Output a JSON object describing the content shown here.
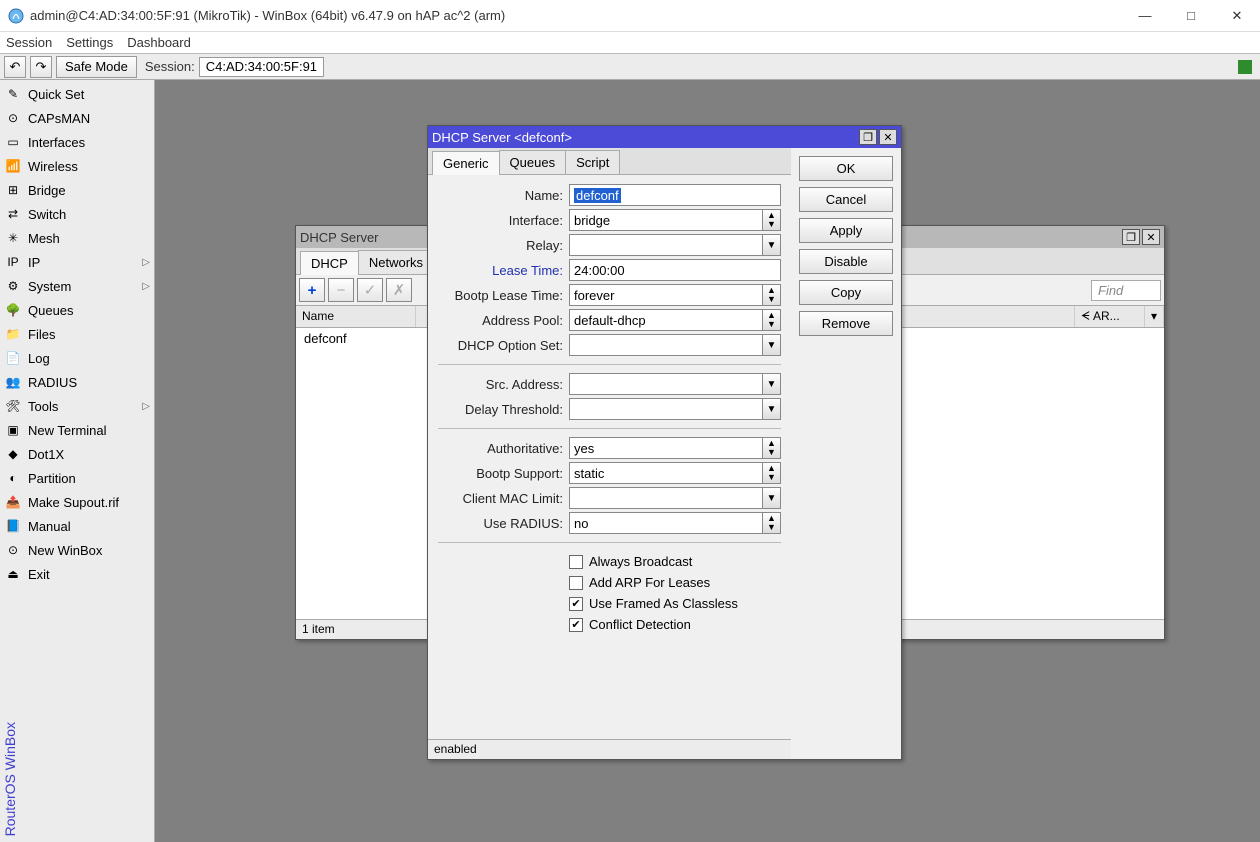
{
  "titlebar": "admin@C4:AD:34:00:5F:91 (MikroTik) - WinBox (64bit) v6.47.9 on hAP ac^2 (arm)",
  "menu": {
    "session": "Session",
    "settings": "Settings",
    "dashboard": "Dashboard"
  },
  "toolbar": {
    "safemode": "Safe Mode",
    "sessionlabel": "Session:",
    "sessionvalue": "C4:AD:34:00:5F:91"
  },
  "sidebar": [
    {
      "label": "Quick Set",
      "icon": "✎",
      "arrow": false
    },
    {
      "label": "CAPsMAN",
      "icon": "⊙",
      "arrow": false
    },
    {
      "label": "Interfaces",
      "icon": "▭",
      "arrow": false
    },
    {
      "label": "Wireless",
      "icon": "📶",
      "arrow": false
    },
    {
      "label": "Bridge",
      "icon": "⊞",
      "arrow": false
    },
    {
      "label": "Switch",
      "icon": "⇄",
      "arrow": false
    },
    {
      "label": "Mesh",
      "icon": "✳",
      "arrow": false
    },
    {
      "label": "IP",
      "icon": "IP",
      "arrow": true
    },
    {
      "label": "System",
      "icon": "⚙",
      "arrow": true
    },
    {
      "label": "Queues",
      "icon": "🌳",
      "arrow": false
    },
    {
      "label": "Files",
      "icon": "📁",
      "arrow": false
    },
    {
      "label": "Log",
      "icon": "📄",
      "arrow": false
    },
    {
      "label": "RADIUS",
      "icon": "👥",
      "arrow": false
    },
    {
      "label": "Tools",
      "icon": "🛠",
      "arrow": true
    },
    {
      "label": "New Terminal",
      "icon": "▣",
      "arrow": false
    },
    {
      "label": "Dot1X",
      "icon": "◆",
      "arrow": false
    },
    {
      "label": "Partition",
      "icon": "◐",
      "arrow": false
    },
    {
      "label": "Make Supout.rif",
      "icon": "📤",
      "arrow": false
    },
    {
      "label": "Manual",
      "icon": "📘",
      "arrow": false
    },
    {
      "label": "New WinBox",
      "icon": "⊙",
      "arrow": false
    },
    {
      "label": "Exit",
      "icon": "⏏",
      "arrow": false
    }
  ],
  "vlabel": "RouterOS  WinBox",
  "listwin": {
    "title": "DHCP Server",
    "tabs": [
      "DHCP",
      "Networks"
    ],
    "activetab": 0,
    "find": "Find",
    "cols": [
      "Name",
      "",
      "ᗕ AR...",
      ""
    ],
    "rows": [
      "defconf"
    ],
    "status": "1 item"
  },
  "dialog": {
    "title": "DHCP Server <defconf>",
    "tabs": [
      "Generic",
      "Queues",
      "Script"
    ],
    "activetab": 0,
    "buttons": [
      "OK",
      "Cancel",
      "Apply",
      "Disable",
      "Copy",
      "Remove"
    ],
    "fields": {
      "name": {
        "label": "Name:",
        "value": "defconf",
        "combo": false,
        "selected": true
      },
      "interface": {
        "label": "Interface:",
        "value": "bridge",
        "combo": "updown"
      },
      "relay": {
        "label": "Relay:",
        "value": "",
        "combo": "down"
      },
      "leasetime": {
        "label": "Lease Time:",
        "value": "24:00:00",
        "combo": false,
        "blue": true
      },
      "bootplease": {
        "label": "Bootp Lease Time:",
        "value": "forever",
        "combo": "updown"
      },
      "addresspool": {
        "label": "Address Pool:",
        "value": "default-dhcp",
        "combo": "updown"
      },
      "optionset": {
        "label": "DHCP Option Set:",
        "value": "",
        "combo": "down"
      },
      "srcaddr": {
        "label": "Src. Address:",
        "value": "",
        "combo": "down"
      },
      "delaythr": {
        "label": "Delay Threshold:",
        "value": "",
        "combo": "down"
      },
      "authoritative": {
        "label": "Authoritative:",
        "value": "yes",
        "combo": "updown"
      },
      "bootpsupport": {
        "label": "Bootp Support:",
        "value": "static",
        "combo": "updown"
      },
      "clientmaclimit": {
        "label": "Client MAC Limit:",
        "value": "",
        "combo": "down"
      },
      "useradius": {
        "label": "Use RADIUS:",
        "value": "no",
        "combo": "updown"
      }
    },
    "checks": [
      {
        "label": "Always Broadcast",
        "checked": false
      },
      {
        "label": "Add ARP For Leases",
        "checked": false
      },
      {
        "label": "Use Framed As Classless",
        "checked": true
      },
      {
        "label": "Conflict Detection",
        "checked": true
      }
    ],
    "status": "enabled"
  }
}
